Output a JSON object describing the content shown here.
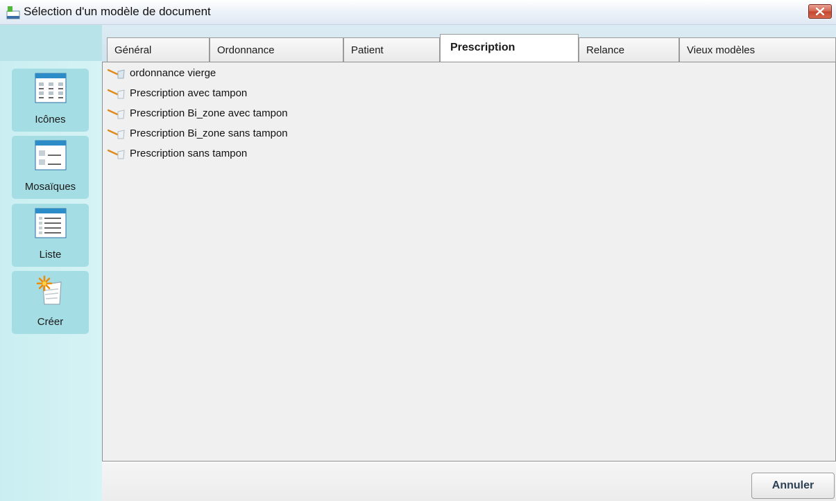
{
  "window": {
    "title": "Sélection d'un modèle de document",
    "icon": "app-icon"
  },
  "sidebar": {
    "buttons": [
      {
        "label": "Icônes",
        "icon": "icons-view-icon"
      },
      {
        "label": "Mosaïques",
        "icon": "tiles-view-icon"
      },
      {
        "label": "Liste",
        "icon": "list-view-icon"
      },
      {
        "label": "Créer",
        "icon": "create-document-icon"
      }
    ]
  },
  "tabs": [
    {
      "label": "Général",
      "active": false
    },
    {
      "label": "Ordonnance",
      "active": false
    },
    {
      "label": "Patient",
      "active": false
    },
    {
      "label": "Prescription",
      "active": true
    },
    {
      "label": "Relance",
      "active": false
    },
    {
      "label": "Vieux modèles",
      "active": false
    }
  ],
  "items": [
    {
      "label": "ordonnance vierge",
      "icon": "document-template-icon"
    },
    {
      "label": "Prescription avec tampon",
      "icon": "document-template-icon"
    },
    {
      "label": "Prescription Bi_zone avec tampon",
      "icon": "document-template-icon"
    },
    {
      "label": "Prescription Bi_zone sans tampon",
      "icon": "document-template-icon"
    },
    {
      "label": "Prescription sans tampon",
      "icon": "document-template-icon"
    }
  ],
  "footer": {
    "cancel_label": "Annuler"
  },
  "colors": {
    "sidebar": "#c9eef1",
    "sidebar_button": "#a4dde4",
    "close": "#c4452d"
  }
}
